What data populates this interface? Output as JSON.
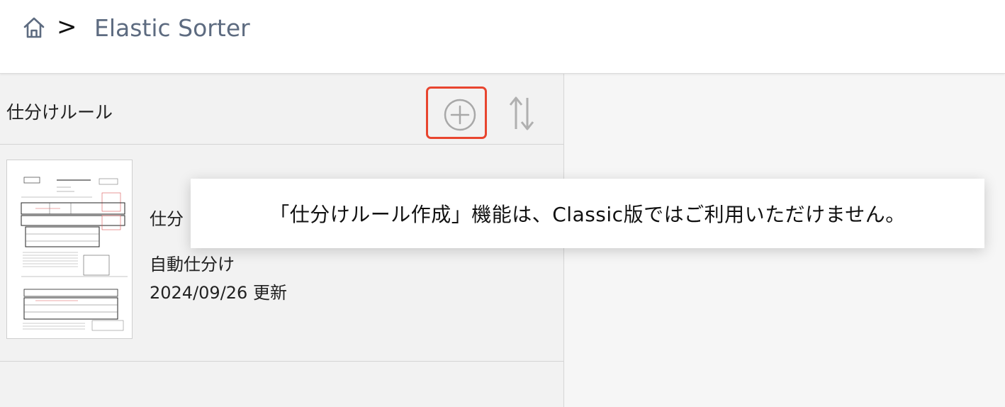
{
  "breadcrumb": {
    "separator": ">",
    "title": "Elastic Sorter"
  },
  "list": {
    "title": "仕分けルール"
  },
  "rule": {
    "name": "仕分",
    "type": "自動仕分け",
    "updated": "2024/09/26 更新"
  },
  "toast": {
    "message": "「仕分けルール作成」機能は、Classic版ではご利用いただけません。"
  },
  "colors": {
    "highlight": "#e8452f",
    "breadcrumb_title": "#5d6b80",
    "icon_gray": "#a8a8a8"
  },
  "icons": [
    "home-icon",
    "add-circle-icon",
    "sort-icon"
  ]
}
